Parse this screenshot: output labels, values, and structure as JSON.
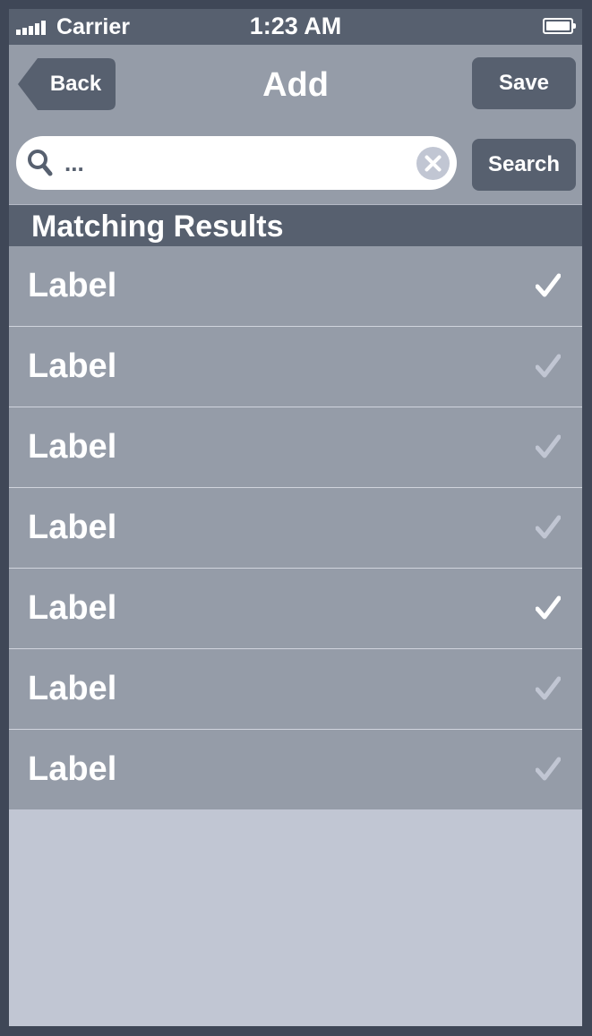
{
  "status_bar": {
    "carrier": "Carrier",
    "time": "1:23 AM",
    "signal_icon": "signal-bars-icon",
    "battery_icon": "battery-full-icon"
  },
  "nav": {
    "back_label": "Back",
    "title": "Add",
    "save_label": "Save"
  },
  "search": {
    "value": "",
    "placeholder": "...",
    "button_label": "Search",
    "search_icon": "magnifier-icon",
    "clear_icon": "clear-circle-icon"
  },
  "section": {
    "title": "Matching Results"
  },
  "results": [
    {
      "label": "Label",
      "checked": true
    },
    {
      "label": "Label",
      "checked": false
    },
    {
      "label": "Label",
      "checked": false
    },
    {
      "label": "Label",
      "checked": false
    },
    {
      "label": "Label",
      "checked": true
    },
    {
      "label": "Label",
      "checked": false
    },
    {
      "label": "Label",
      "checked": false
    }
  ],
  "colors": {
    "frame": "#3f4757",
    "status_bar": "#57606f",
    "nav_bar": "#959ca8",
    "button": "#57606f",
    "section_header": "#57606f",
    "list_item": "#959ca8",
    "empty_area": "#c1c6d3",
    "check_active": "#ffffff",
    "check_inactive": "#c1c6d3"
  }
}
